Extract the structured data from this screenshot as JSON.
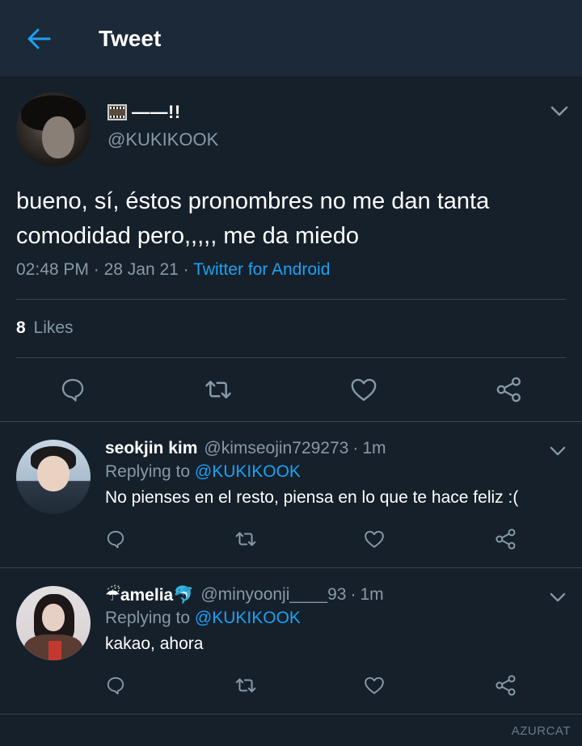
{
  "header": {
    "title": "Tweet",
    "back_icon": "arrow-left-icon"
  },
  "colors": {
    "accent": "#1da1f2",
    "background": "#15202b",
    "header_bg": "#1c2938",
    "muted": "#8899a6",
    "divider": "#38444d"
  },
  "main_tweet": {
    "display_name": "——!!",
    "name_icon": "film-frames-icon",
    "handle": "@KUKIKOOK",
    "text_line1": "bueno, sí, éstos pronombres no me dan tanta",
    "text_line2": "comodidad pero,,,,, me da miedo",
    "time": "02:48 PM",
    "date": "28 Jan 21",
    "separator": "·",
    "source": "Twitter for Android",
    "likes_count": "8",
    "likes_label": "Likes",
    "actions": [
      "reply-icon",
      "retweet-icon",
      "like-icon",
      "share-icon"
    ]
  },
  "replies": [
    {
      "name": "seokjin kim",
      "handle": "@kimseojin729273",
      "separator": "·",
      "time": "1m",
      "replying_prefix": "Replying to",
      "replying_to": "@KUKIKOOK",
      "text": "No pienses en el resto, piensa en lo que te hace feliz :("
    },
    {
      "name": "☔amelia🐬",
      "handle": "@minyoonji____93",
      "separator": "·",
      "time": "1m",
      "replying_prefix": "Replying to",
      "replying_to": "@KUKIKOOK",
      "text": "kakao, ahora"
    }
  ],
  "watermark": "AZURCAT"
}
